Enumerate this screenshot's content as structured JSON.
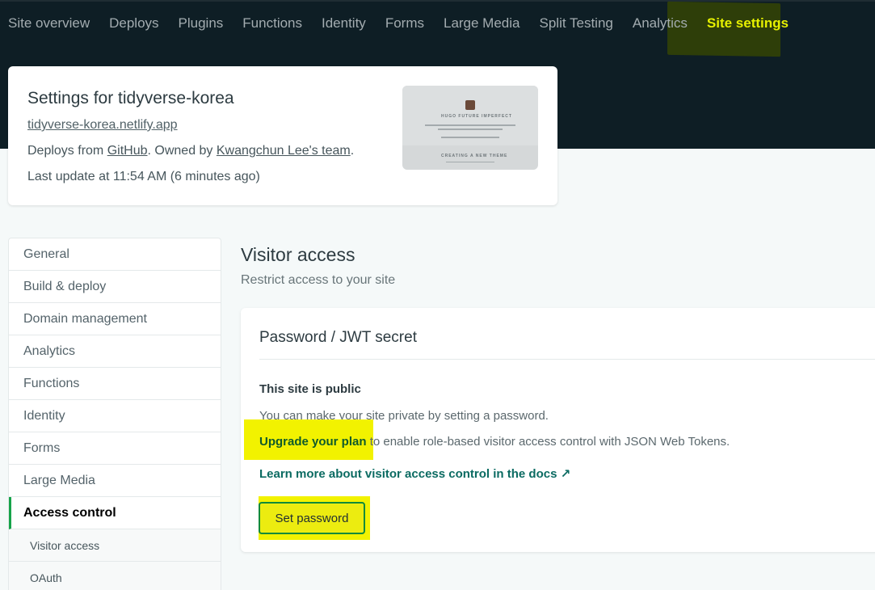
{
  "nav": {
    "items": [
      {
        "label": "Site overview"
      },
      {
        "label": "Deploys"
      },
      {
        "label": "Plugins"
      },
      {
        "label": "Functions"
      },
      {
        "label": "Identity"
      },
      {
        "label": "Forms"
      },
      {
        "label": "Large Media"
      },
      {
        "label": "Split Testing"
      },
      {
        "label": "Analytics"
      },
      {
        "label": "Site settings"
      }
    ],
    "active": "Site settings"
  },
  "site": {
    "title": "Settings for tidyverse-korea",
    "url": "tidyverse-korea.netlify.app",
    "deploys_prefix": "Deploys from ",
    "deploys_source": "GitHub",
    "owned_prefix": ". Owned by ",
    "owner": "Kwangchun Lee's team",
    "owned_suffix": ".",
    "last_update": "Last update at 11:54 AM (6 minutes ago)",
    "thumbnail": {
      "heading": "HUGO FUTURE IMPERFECT",
      "section": "CREATING A NEW THEME"
    }
  },
  "sidebar": {
    "items": [
      {
        "label": "General"
      },
      {
        "label": "Build & deploy"
      },
      {
        "label": "Domain management"
      },
      {
        "label": "Analytics"
      },
      {
        "label": "Functions"
      },
      {
        "label": "Identity"
      },
      {
        "label": "Forms"
      },
      {
        "label": "Large Media"
      },
      {
        "label": "Access control"
      }
    ],
    "subitems": [
      {
        "label": "Visitor access"
      },
      {
        "label": "OAuth"
      }
    ]
  },
  "main": {
    "title": "Visitor access",
    "subtitle": "Restrict access to your site",
    "card": {
      "title": "Password / JWT secret",
      "status": "This site is public",
      "desc": "You can make your site private by setting a password.",
      "upgrade_link": "Upgrade your plan",
      "upgrade_rest": " to enable role-based visitor access control with JSON Web Tokens.",
      "docs_link": "Learn more about visitor access control in the docs",
      "docs_arrow": "↗",
      "button": "Set password"
    }
  }
}
